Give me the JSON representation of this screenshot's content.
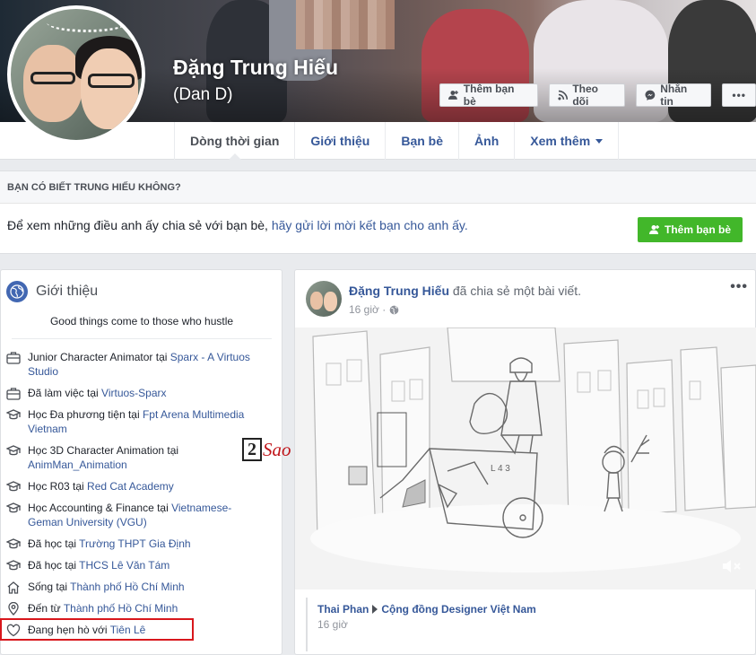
{
  "profile": {
    "name": "Đặng Trung Hiếu",
    "alternate_name": "(Dan D)"
  },
  "cover_actions": {
    "add_friend": "Thêm bạn bè",
    "follow": "Theo dõi",
    "message": "Nhắn tin",
    "more": "•••"
  },
  "tabs": [
    {
      "label": "Dòng thời gian",
      "active": true
    },
    {
      "label": "Giới thiệu"
    },
    {
      "label": "Bạn bè"
    },
    {
      "label": "Ảnh"
    },
    {
      "label": "Xem thêm"
    }
  ],
  "friend_prompt": {
    "heading": "BẠN CÓ BIẾT TRUNG HIẾU KHÔNG?",
    "text": "Để xem những điều anh ấy chia sẻ với bạn bè, ",
    "link": "hãy gửi lời mời kết bạn cho anh ấy.",
    "button": "Thêm bạn bè"
  },
  "intro": {
    "title": "Giới thiệu",
    "bio": "Good things come to those who hustle",
    "items": [
      {
        "icon": "briefcase-icon",
        "text": "Junior Character Animator tại ",
        "link": "Sparx - A Virtuos Studio"
      },
      {
        "icon": "briefcase-icon",
        "text": "Đã làm việc tại ",
        "link": "Virtuos-Sparx"
      },
      {
        "icon": "graduation-cap-icon",
        "text": "Học Đa phương tiện tại ",
        "link": "Fpt Arena Multimedia Vietnam"
      },
      {
        "icon": "graduation-cap-icon",
        "text": "Học 3D Character Animation tại ",
        "link": "AnimMan_Animation"
      },
      {
        "icon": "graduation-cap-icon",
        "text": "Học R03 tại ",
        "link": "Red Cat Academy"
      },
      {
        "icon": "graduation-cap-icon",
        "text": "Học Accounting & Finance tại ",
        "link": "Vietnamese-Geman University (VGU)"
      },
      {
        "icon": "graduation-cap-icon",
        "text": "Đã học tại ",
        "link": "Trường THPT Gia Định"
      },
      {
        "icon": "graduation-cap-icon",
        "text": "Đã học tại ",
        "link": "THCS Lê Văn Tám"
      },
      {
        "icon": "home-icon",
        "text": "Sống tại ",
        "link": "Thành phố Hồ Chí Minh"
      },
      {
        "icon": "location-pin-icon",
        "text": "Đến từ ",
        "link": "Thành phố Hồ Chí Minh"
      },
      {
        "icon": "heart-icon",
        "text": "Đang hẹn hò với ",
        "link": "Tiên Lê"
      }
    ]
  },
  "watermark": {
    "number": "2",
    "text": "Sao"
  },
  "post": {
    "author": "Đặng Trung Hiếu",
    "action": " đã chia sẻ một bài viết.",
    "time": "16 giờ ·",
    "more": "•••",
    "shared": {
      "from": "Thai Phan",
      "to": "Cộng đồng Designer Việt Nam",
      "time": "16 giờ"
    }
  }
}
